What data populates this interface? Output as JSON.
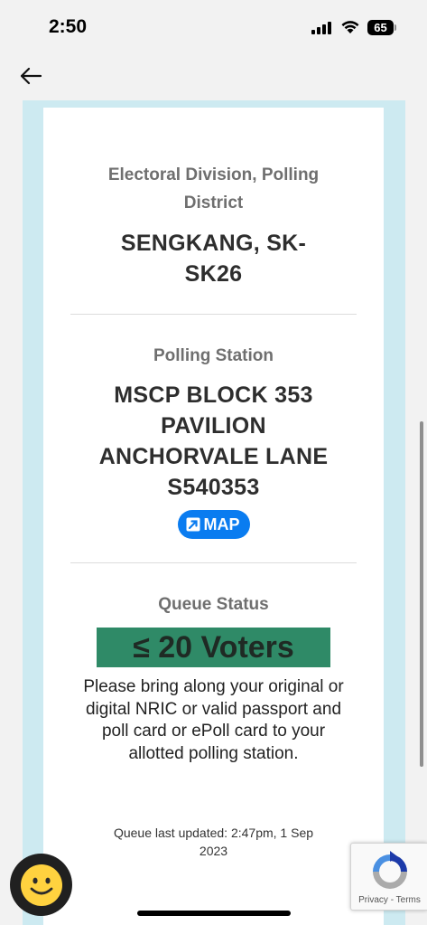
{
  "status_bar": {
    "time": "2:50",
    "battery": "65"
  },
  "card": {
    "division_label": "Electoral Division, Polling District",
    "division_value_line1": "SENGKANG, SK-",
    "division_value_line2": "SK26",
    "station_label": "Polling Station",
    "station_lines": [
      "MSCP BLOCK 353",
      "PAVILION",
      "ANCHORVALE LANE",
      "S540353"
    ],
    "map_button_label": "MAP",
    "queue_label": "Queue Status",
    "queue_value": "≤ 20 Voters",
    "queue_color": "#2f8a67",
    "message": "Please bring along your original or digital NRIC or valid passport and poll card or ePoll card to your allotted polling station.",
    "updated_line1": "Queue last updated: 2:47pm, 1 Sep",
    "updated_line2": "2023"
  },
  "recaptcha": {
    "links": "Privacy - Terms"
  },
  "icons": {
    "back": "arrow-left-icon",
    "map": "external-link-icon",
    "feedback": "smiley-icon",
    "recaptcha": "recaptcha-icon"
  }
}
